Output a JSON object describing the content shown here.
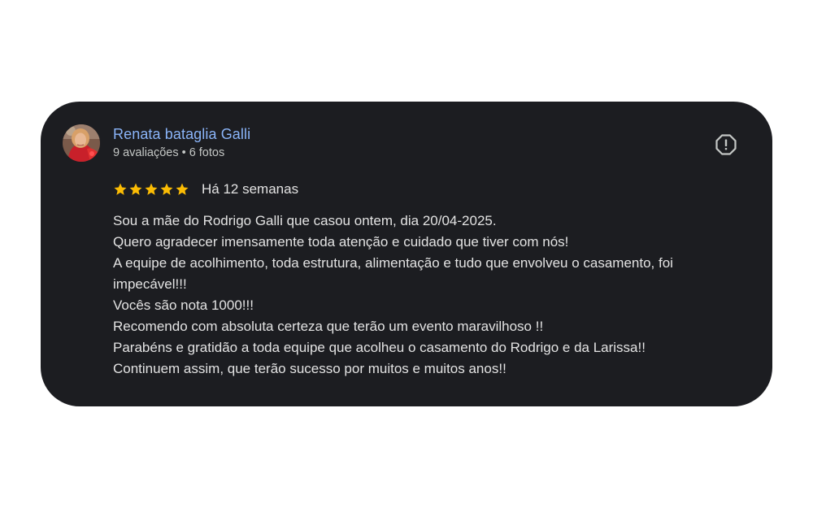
{
  "review": {
    "reviewer": {
      "name": "Renata bataglia Galli",
      "reviews_count": "9 avaliações",
      "separator": "•",
      "photos_count": "6 fotos",
      "avatar_icon": "user-photo-avatar"
    },
    "rating": {
      "stars": 5,
      "max_stars": 5,
      "star_color": "#fbbc04"
    },
    "date": "Há 12 semanas",
    "report_icon": "report-icon",
    "text_lines": [
      "Sou a mãe do Rodrigo Galli que casou ontem, dia 20/04-2025.",
      "Quero agradecer imensamente toda atenção e cuidado que tiver com nós!",
      "A equipe de acolhimento, toda estrutura, alimentação e tudo que envolveu o casamento, foi",
      "impecável!!!",
      "Vocês são nota 1000!!!",
      "Recomendo com absoluta certeza que terão um evento maravilhoso !!",
      "Parabéns e gratidão a toda equipe que acolheu o casamento do Rodrigo e da Larissa!!",
      "Continuem assim, que terão sucesso por muitos e muitos anos!!"
    ]
  },
  "colors": {
    "card_background": "#1c1d21",
    "name_link": "#8ab4f8",
    "body_text": "#e3e3e3",
    "meta_text": "#c4c7c5"
  }
}
